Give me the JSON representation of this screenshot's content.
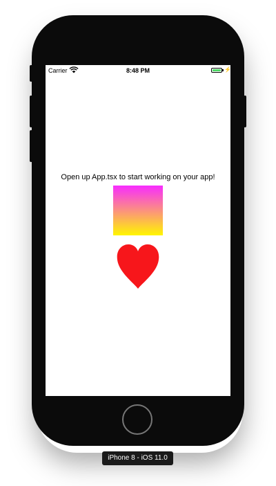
{
  "status_bar": {
    "carrier": "Carrier",
    "time": "8:48 PM",
    "battery_level": 1.0,
    "charging": true
  },
  "app": {
    "message": "Open up App.tsx to start working on your app!",
    "gradient": {
      "top_color": "#f72cff",
      "bottom_color": "#fff600"
    },
    "heart_color": "#f7161b"
  },
  "device_label": "iPhone 8 - iOS 11.0"
}
